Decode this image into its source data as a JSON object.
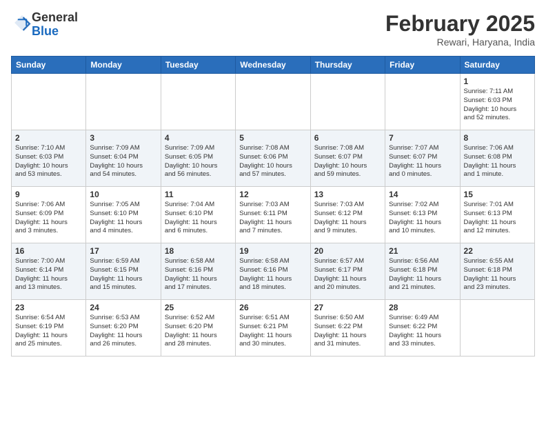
{
  "header": {
    "logo_general": "General",
    "logo_blue": "Blue",
    "month_title": "February 2025",
    "location": "Rewari, Haryana, India"
  },
  "days_of_week": [
    "Sunday",
    "Monday",
    "Tuesday",
    "Wednesday",
    "Thursday",
    "Friday",
    "Saturday"
  ],
  "weeks": [
    {
      "days": [
        {
          "num": "",
          "info": ""
        },
        {
          "num": "",
          "info": ""
        },
        {
          "num": "",
          "info": ""
        },
        {
          "num": "",
          "info": ""
        },
        {
          "num": "",
          "info": ""
        },
        {
          "num": "",
          "info": ""
        },
        {
          "num": "1",
          "info": "Sunrise: 7:11 AM\nSunset: 6:03 PM\nDaylight: 10 hours\nand 52 minutes."
        }
      ]
    },
    {
      "days": [
        {
          "num": "2",
          "info": "Sunrise: 7:10 AM\nSunset: 6:03 PM\nDaylight: 10 hours\nand 53 minutes."
        },
        {
          "num": "3",
          "info": "Sunrise: 7:09 AM\nSunset: 6:04 PM\nDaylight: 10 hours\nand 54 minutes."
        },
        {
          "num": "4",
          "info": "Sunrise: 7:09 AM\nSunset: 6:05 PM\nDaylight: 10 hours\nand 56 minutes."
        },
        {
          "num": "5",
          "info": "Sunrise: 7:08 AM\nSunset: 6:06 PM\nDaylight: 10 hours\nand 57 minutes."
        },
        {
          "num": "6",
          "info": "Sunrise: 7:08 AM\nSunset: 6:07 PM\nDaylight: 10 hours\nand 59 minutes."
        },
        {
          "num": "7",
          "info": "Sunrise: 7:07 AM\nSunset: 6:07 PM\nDaylight: 11 hours\nand 0 minutes."
        },
        {
          "num": "8",
          "info": "Sunrise: 7:06 AM\nSunset: 6:08 PM\nDaylight: 11 hours\nand 1 minute."
        }
      ]
    },
    {
      "days": [
        {
          "num": "9",
          "info": "Sunrise: 7:06 AM\nSunset: 6:09 PM\nDaylight: 11 hours\nand 3 minutes."
        },
        {
          "num": "10",
          "info": "Sunrise: 7:05 AM\nSunset: 6:10 PM\nDaylight: 11 hours\nand 4 minutes."
        },
        {
          "num": "11",
          "info": "Sunrise: 7:04 AM\nSunset: 6:10 PM\nDaylight: 11 hours\nand 6 minutes."
        },
        {
          "num": "12",
          "info": "Sunrise: 7:03 AM\nSunset: 6:11 PM\nDaylight: 11 hours\nand 7 minutes."
        },
        {
          "num": "13",
          "info": "Sunrise: 7:03 AM\nSunset: 6:12 PM\nDaylight: 11 hours\nand 9 minutes."
        },
        {
          "num": "14",
          "info": "Sunrise: 7:02 AM\nSunset: 6:13 PM\nDaylight: 11 hours\nand 10 minutes."
        },
        {
          "num": "15",
          "info": "Sunrise: 7:01 AM\nSunset: 6:13 PM\nDaylight: 11 hours\nand 12 minutes."
        }
      ]
    },
    {
      "days": [
        {
          "num": "16",
          "info": "Sunrise: 7:00 AM\nSunset: 6:14 PM\nDaylight: 11 hours\nand 13 minutes."
        },
        {
          "num": "17",
          "info": "Sunrise: 6:59 AM\nSunset: 6:15 PM\nDaylight: 11 hours\nand 15 minutes."
        },
        {
          "num": "18",
          "info": "Sunrise: 6:58 AM\nSunset: 6:16 PM\nDaylight: 11 hours\nand 17 minutes."
        },
        {
          "num": "19",
          "info": "Sunrise: 6:58 AM\nSunset: 6:16 PM\nDaylight: 11 hours\nand 18 minutes."
        },
        {
          "num": "20",
          "info": "Sunrise: 6:57 AM\nSunset: 6:17 PM\nDaylight: 11 hours\nand 20 minutes."
        },
        {
          "num": "21",
          "info": "Sunrise: 6:56 AM\nSunset: 6:18 PM\nDaylight: 11 hours\nand 21 minutes."
        },
        {
          "num": "22",
          "info": "Sunrise: 6:55 AM\nSunset: 6:18 PM\nDaylight: 11 hours\nand 23 minutes."
        }
      ]
    },
    {
      "days": [
        {
          "num": "23",
          "info": "Sunrise: 6:54 AM\nSunset: 6:19 PM\nDaylight: 11 hours\nand 25 minutes."
        },
        {
          "num": "24",
          "info": "Sunrise: 6:53 AM\nSunset: 6:20 PM\nDaylight: 11 hours\nand 26 minutes."
        },
        {
          "num": "25",
          "info": "Sunrise: 6:52 AM\nSunset: 6:20 PM\nDaylight: 11 hours\nand 28 minutes."
        },
        {
          "num": "26",
          "info": "Sunrise: 6:51 AM\nSunset: 6:21 PM\nDaylight: 11 hours\nand 30 minutes."
        },
        {
          "num": "27",
          "info": "Sunrise: 6:50 AM\nSunset: 6:22 PM\nDaylight: 11 hours\nand 31 minutes."
        },
        {
          "num": "28",
          "info": "Sunrise: 6:49 AM\nSunset: 6:22 PM\nDaylight: 11 hours\nand 33 minutes."
        },
        {
          "num": "",
          "info": ""
        }
      ]
    }
  ]
}
